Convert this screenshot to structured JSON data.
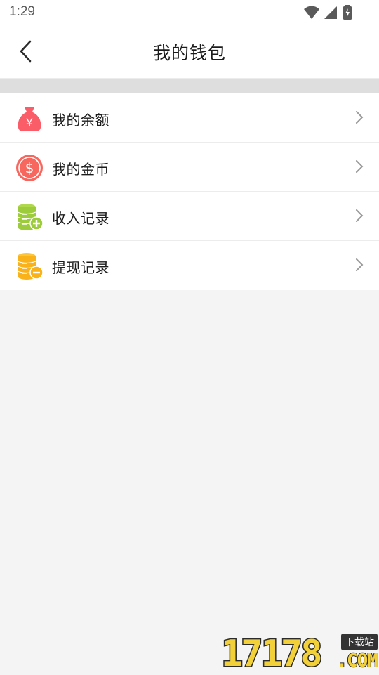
{
  "status_bar": {
    "time": "1:29",
    "icons": [
      "wifi-icon",
      "cell-signal-icon",
      "battery-charging-icon"
    ]
  },
  "header": {
    "title": "我的钱包",
    "back_icon": "chevron-left-icon"
  },
  "menu": {
    "items": [
      {
        "label": "我的余额",
        "icon": "money-bag-icon",
        "accent": "#fb5d68"
      },
      {
        "label": "我的金币",
        "icon": "dollar-coin-icon",
        "accent": "#f8675e"
      },
      {
        "label": "收入记录",
        "icon": "coins-plus-icon",
        "accent": "#9ccc3c"
      },
      {
        "label": "提现记录",
        "icon": "coins-minus-icon",
        "accent": "#f9b21a"
      }
    ],
    "chevron_icon": "chevron-right-icon"
  },
  "watermark": {
    "digits": "17178",
    "badge": "下载站",
    "suffix": ".COM"
  },
  "colors": {
    "background": "#f4f4f4",
    "surface": "#ffffff",
    "divider": "#ececec",
    "band": "#dedede"
  }
}
